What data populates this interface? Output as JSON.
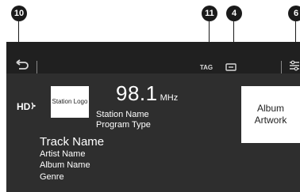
{
  "callouts": {
    "back": "10",
    "tag": "11",
    "channel": "4",
    "settings": "6"
  },
  "toolbar": {
    "tag_label": "TAG"
  },
  "station": {
    "logo_text": "Station Logo",
    "frequency": "98.1",
    "unit": "MHz",
    "name": "Station Name",
    "program_type": "Program Type"
  },
  "album": {
    "artwork_text": "Album Artwork"
  },
  "track": {
    "name": "Track Name",
    "artist": "Artist Name",
    "album": "Album Name",
    "genre": "Genre"
  },
  "icons": {
    "back": "back-arrow-icon",
    "hd": "hd-radio-icon",
    "channel": "channel-icon",
    "settings": "settings-icon"
  }
}
